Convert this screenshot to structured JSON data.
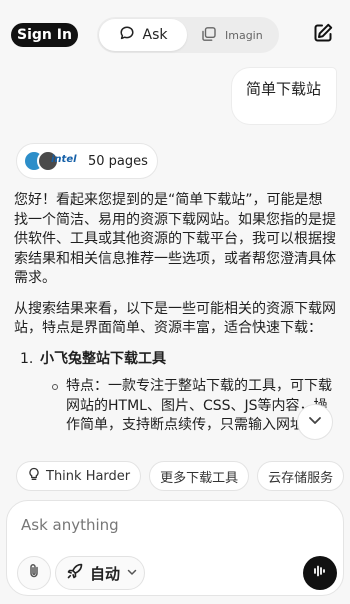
{
  "header": {
    "signin_label": "Sign In",
    "mode_ask_label": "Ask",
    "mode_imagine_label": "Imagin"
  },
  "conversation": {
    "user_message": "简单下载站",
    "sources": {
      "logo_text": "intel",
      "count_label": "50 pages"
    },
    "answer": {
      "intro": "您好！看起来您提到的是“简单下载站”，可能是想找一个简洁、易用的资源下载网站。如果您指的是提供软件、工具或其他资源的下载平台，我可以根据搜索结果和相关信息推荐一些选项，或者帮您澄清具体需求。",
      "lead": "从搜索结果来看，以下是一些可能相关的资源下载网站，特点是界面简单、资源丰富，适合快速下载：",
      "items": [
        {
          "number": "1.",
          "title": "小飞兔整站下载工具",
          "detail": "特点：一款专注于整站下载的工具，可下载网站的HTML、图片、CSS、JS等内容，操作简单，支持断点续传，只需输入网址即可完成下载。"
        }
      ]
    }
  },
  "suggestions": [
    {
      "label": "Think Harder",
      "icon": "lightbulb-icon"
    },
    {
      "label": "更多下载工具"
    },
    {
      "label": "云存储服务"
    }
  ],
  "composer": {
    "placeholder": "Ask anything",
    "model_label": "自动"
  }
}
